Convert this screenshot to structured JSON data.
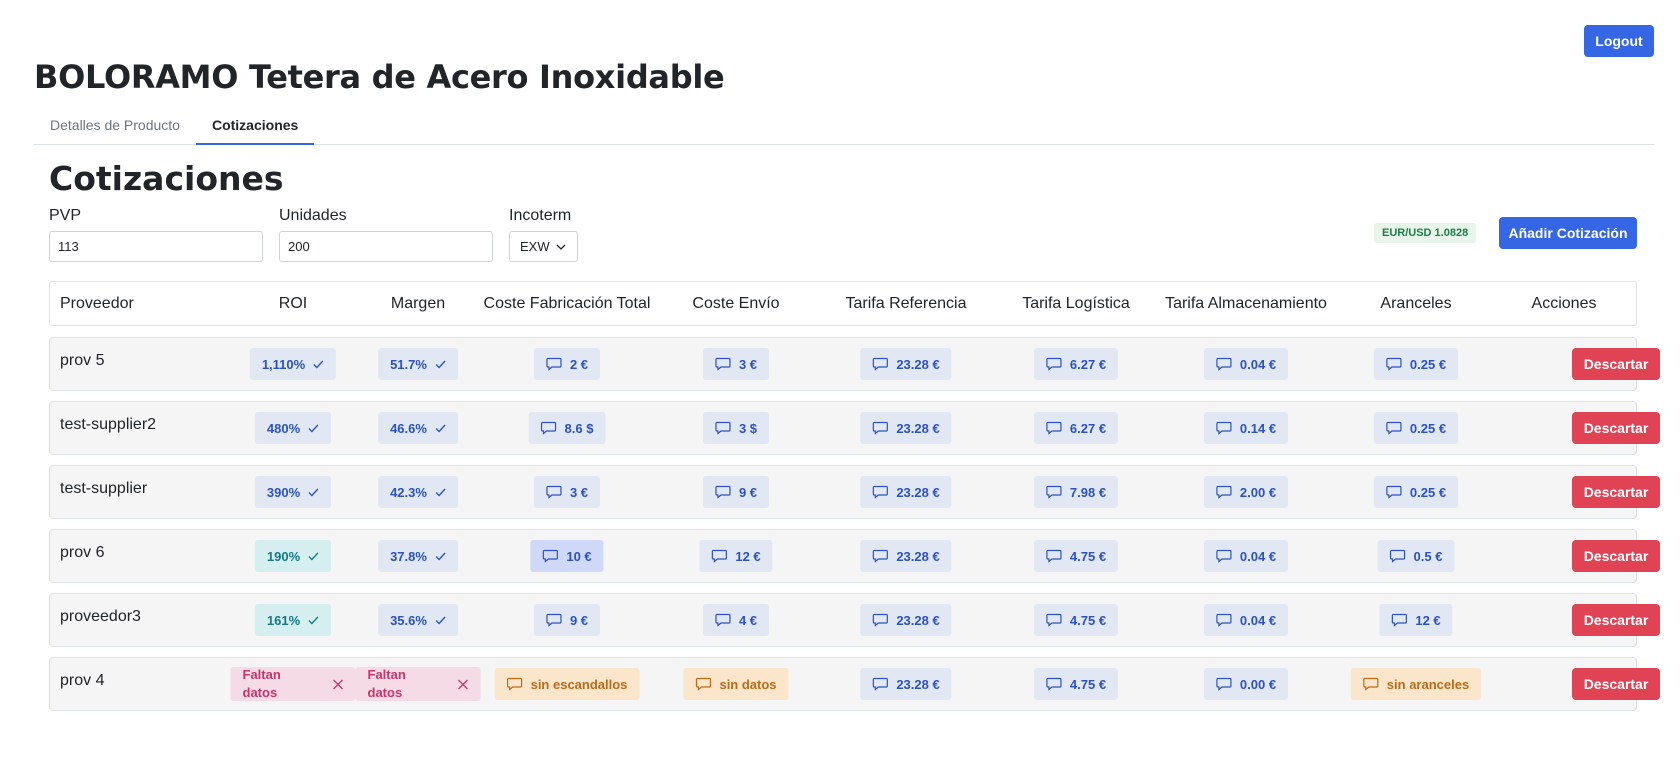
{
  "header": {
    "logout_label": "Logout",
    "product_title": "BOLORAMO Tetera de Acero Inoxidable"
  },
  "tabs": [
    {
      "label": "Detalles de Producto"
    },
    {
      "label": "Cotizaciones"
    }
  ],
  "section": {
    "title": "Cotizaciones",
    "pvp": {
      "label": "PVP",
      "value": "113"
    },
    "units": {
      "label": "Unidades",
      "value": "200"
    },
    "incoterm": {
      "label": "Incoterm",
      "value": "EXW"
    },
    "rate": "EUR/USD 1.0828",
    "add_label": "Añadir Cotización"
  },
  "columns": [
    "Proveedor",
    "ROI",
    "Margen",
    "Coste Fabricación Total",
    "Coste Envío",
    "Tarifa Referencia",
    "Tarifa Logística",
    "Tarifa Almacenamiento",
    "Aranceles",
    "Acciones"
  ],
  "action_label": "Descartar",
  "rows": [
    {
      "name": "prov 5",
      "roi": "1,110%",
      "margin": "51.7%",
      "fab": "2 €",
      "ship": "3 €",
      "ref": "23.28 €",
      "log": "6.27 €",
      "store": "0.04 €",
      "tariff": "0.25 €"
    },
    {
      "name": "test-supplier2",
      "roi": "480%",
      "margin": "46.6%",
      "fab": "8.6 $",
      "ship": "3 $",
      "ref": "23.28 €",
      "log": "6.27 €",
      "store": "0.14 €",
      "tariff": "0.25 €"
    },
    {
      "name": "test-supplier",
      "roi": "390%",
      "margin": "42.3%",
      "fab": "3 €",
      "ship": "9 €",
      "ref": "23.28 €",
      "log": "7.98 €",
      "store": "2.00 €",
      "tariff": "0.25 €"
    },
    {
      "name": "prov 6",
      "roi": "190%",
      "margin": "37.8%",
      "fab": "10 €",
      "ship": "12 €",
      "ref": "23.28 €",
      "log": "4.75 €",
      "store": "0.04 €",
      "tariff": "0.5 €"
    },
    {
      "name": "proveedor3",
      "roi": "161%",
      "margin": "35.6%",
      "fab": "9 €",
      "ship": "4 €",
      "ref": "23.28 €",
      "log": "4.75 €",
      "store": "0.04 €",
      "tariff": "12 €"
    },
    {
      "name": "prov 4",
      "roi": "Faltan datos",
      "margin": "Faltan datos",
      "fab": "sin escandallos",
      "ship": "sin datos",
      "ref": "23.28 €",
      "log": "4.75 €",
      "store": "0.00 €",
      "tariff": "sin aranceles"
    }
  ],
  "colors": {
    "primary": "#3566e4",
    "danger": "#e04353",
    "pill_blue": "#e1e8f4",
    "pill_teal": "#d5eff1",
    "pill_orange": "#fbe6cc",
    "pill_pink": "#f5dbe6",
    "badge_green": "#e6f4ea"
  },
  "icons": {
    "comment": "comment-icon",
    "check": "check-icon",
    "close": "close-icon",
    "chevron": "chevron-down-icon"
  }
}
